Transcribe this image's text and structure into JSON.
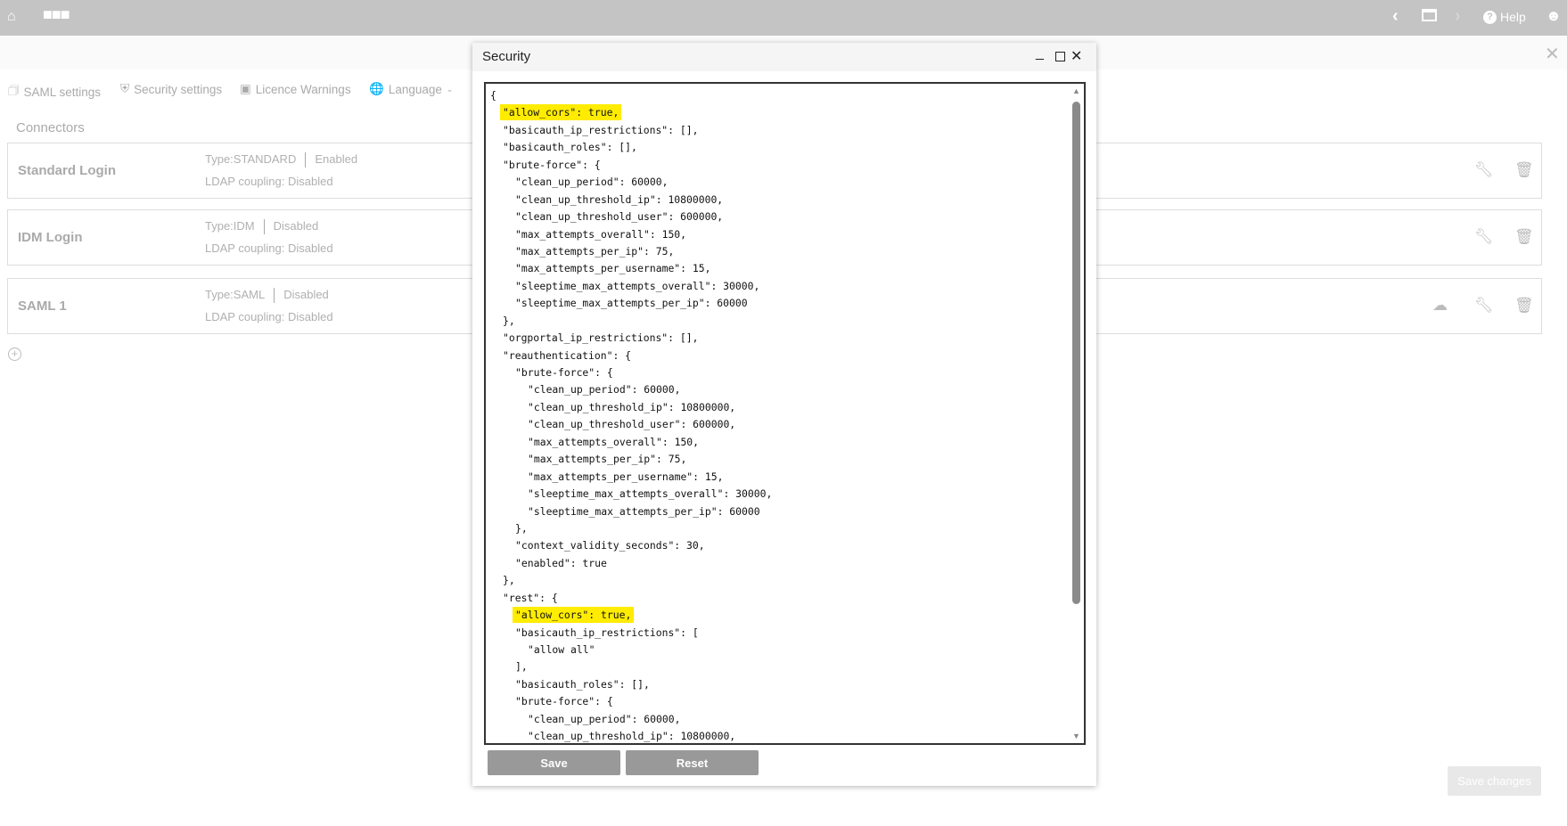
{
  "topbar": {
    "icons": [
      "home-icon",
      "more-icon",
      "back-icon",
      "window-icon",
      "forward-icon",
      "user-icon"
    ],
    "help_label": "Help"
  },
  "tabs": [
    {
      "label": "SAML settings",
      "icon": "id-card-icon"
    },
    {
      "label": "Security settings",
      "icon": "shield-icon"
    },
    {
      "label": "Licence Warnings",
      "icon": "credit-card-icon"
    },
    {
      "label": "Language",
      "icon": "translate-icon"
    }
  ],
  "connectors_label": "Connectors",
  "connectors": [
    {
      "name": "Standard Login",
      "type": "Type:STANDARD",
      "status": "Enabled",
      "ldap": "LDAP coupling: Disabled",
      "download": false
    },
    {
      "name": "IDM Login",
      "type": "Type:IDM",
      "status": "Disabled",
      "ldap": "LDAP coupling: Disabled",
      "download": false
    },
    {
      "name": "SAML 1",
      "type": "Type:SAML",
      "status": "Disabled",
      "ldap": "LDAP coupling: Disabled",
      "download": true
    }
  ],
  "save_changes_label": "Save changes",
  "dialog": {
    "title": "Security",
    "save_label": "Save",
    "reset_label": "Reset",
    "highlight_color": "#ffec00",
    "lines": [
      {
        "i": 0,
        "t": "{"
      },
      {
        "i": 1,
        "t": "\"allow_cors\": true,",
        "h": true
      },
      {
        "i": 1,
        "t": "\"basicauth_ip_restrictions\": [],"
      },
      {
        "i": 1,
        "t": "\"basicauth_roles\": [],"
      },
      {
        "i": 1,
        "t": "\"brute-force\": {"
      },
      {
        "i": 2,
        "t": "\"clean_up_period\": 60000,"
      },
      {
        "i": 2,
        "t": "\"clean_up_threshold_ip\": 10800000,"
      },
      {
        "i": 2,
        "t": "\"clean_up_threshold_user\": 600000,"
      },
      {
        "i": 2,
        "t": "\"max_attempts_overall\": 150,"
      },
      {
        "i": 2,
        "t": "\"max_attempts_per_ip\": 75,"
      },
      {
        "i": 2,
        "t": "\"max_attempts_per_username\": 15,"
      },
      {
        "i": 2,
        "t": "\"sleeptime_max_attempts_overall\": 30000,"
      },
      {
        "i": 2,
        "t": "\"sleeptime_max_attempts_per_ip\": 60000"
      },
      {
        "i": 1,
        "t": "},"
      },
      {
        "i": 1,
        "t": "\"orgportal_ip_restrictions\": [],"
      },
      {
        "i": 1,
        "t": "\"reauthentication\": {"
      },
      {
        "i": 2,
        "t": "\"brute-force\": {"
      },
      {
        "i": 3,
        "t": "\"clean_up_period\": 60000,"
      },
      {
        "i": 3,
        "t": "\"clean_up_threshold_ip\": 10800000,"
      },
      {
        "i": 3,
        "t": "\"clean_up_threshold_user\": 600000,"
      },
      {
        "i": 3,
        "t": "\"max_attempts_overall\": 150,"
      },
      {
        "i": 3,
        "t": "\"max_attempts_per_ip\": 75,"
      },
      {
        "i": 3,
        "t": "\"max_attempts_per_username\": 15,"
      },
      {
        "i": 3,
        "t": "\"sleeptime_max_attempts_overall\": 30000,"
      },
      {
        "i": 3,
        "t": "\"sleeptime_max_attempts_per_ip\": 60000"
      },
      {
        "i": 2,
        "t": "},"
      },
      {
        "i": 2,
        "t": "\"context_validity_seconds\": 30,"
      },
      {
        "i": 2,
        "t": "\"enabled\": true"
      },
      {
        "i": 1,
        "t": "},"
      },
      {
        "i": 1,
        "t": "\"rest\": {"
      },
      {
        "i": 2,
        "t": "\"allow_cors\": true,",
        "h": true
      },
      {
        "i": 2,
        "t": "\"basicauth_ip_restrictions\": ["
      },
      {
        "i": 3,
        "t": "\"allow all\""
      },
      {
        "i": 2,
        "t": "],"
      },
      {
        "i": 2,
        "t": "\"basicauth_roles\": [],"
      },
      {
        "i": 2,
        "t": "\"brute-force\": {"
      },
      {
        "i": 3,
        "t": "\"clean_up_period\": 60000,"
      },
      {
        "i": 3,
        "t": "\"clean_up_threshold_ip\": 10800000,"
      }
    ]
  }
}
